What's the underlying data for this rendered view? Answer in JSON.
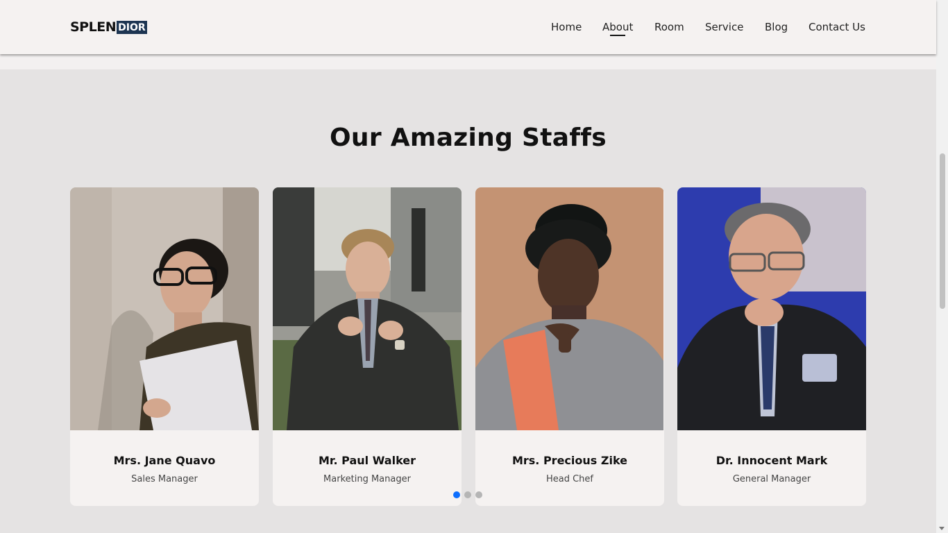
{
  "header": {
    "logo_main": "SPLEN",
    "logo_box": "DIOR",
    "nav": [
      {
        "label": "Home",
        "active": false
      },
      {
        "label": "About",
        "active": true
      },
      {
        "label": "Room",
        "active": false
      },
      {
        "label": "Service",
        "active": false
      },
      {
        "label": "Blog",
        "active": false
      },
      {
        "label": "Contact Us",
        "active": false
      }
    ]
  },
  "section": {
    "title": "Our Amazing Staffs"
  },
  "staff": [
    {
      "name": "Mrs. Jane Quavo",
      "role": "Sales Manager",
      "photo": "woman-glasses-photo"
    },
    {
      "name": "Mr. Paul Walker",
      "role": "Marketing Manager",
      "photo": "man-suit-photo"
    },
    {
      "name": "Mrs. Precious Zike",
      "role": "Head Chef",
      "photo": "woman-portrait-photo"
    },
    {
      "name": "Dr. Innocent Mark",
      "role": "General Manager",
      "photo": "man-glasses-photo"
    }
  ],
  "carousel": {
    "dots": 3,
    "active_index": 0
  },
  "colors": {
    "header_bg": "#f5f2f1",
    "page_bg": "#e5e3e3",
    "logo_box_bg": "#1d3552",
    "active_dot": "#0d6efd"
  }
}
